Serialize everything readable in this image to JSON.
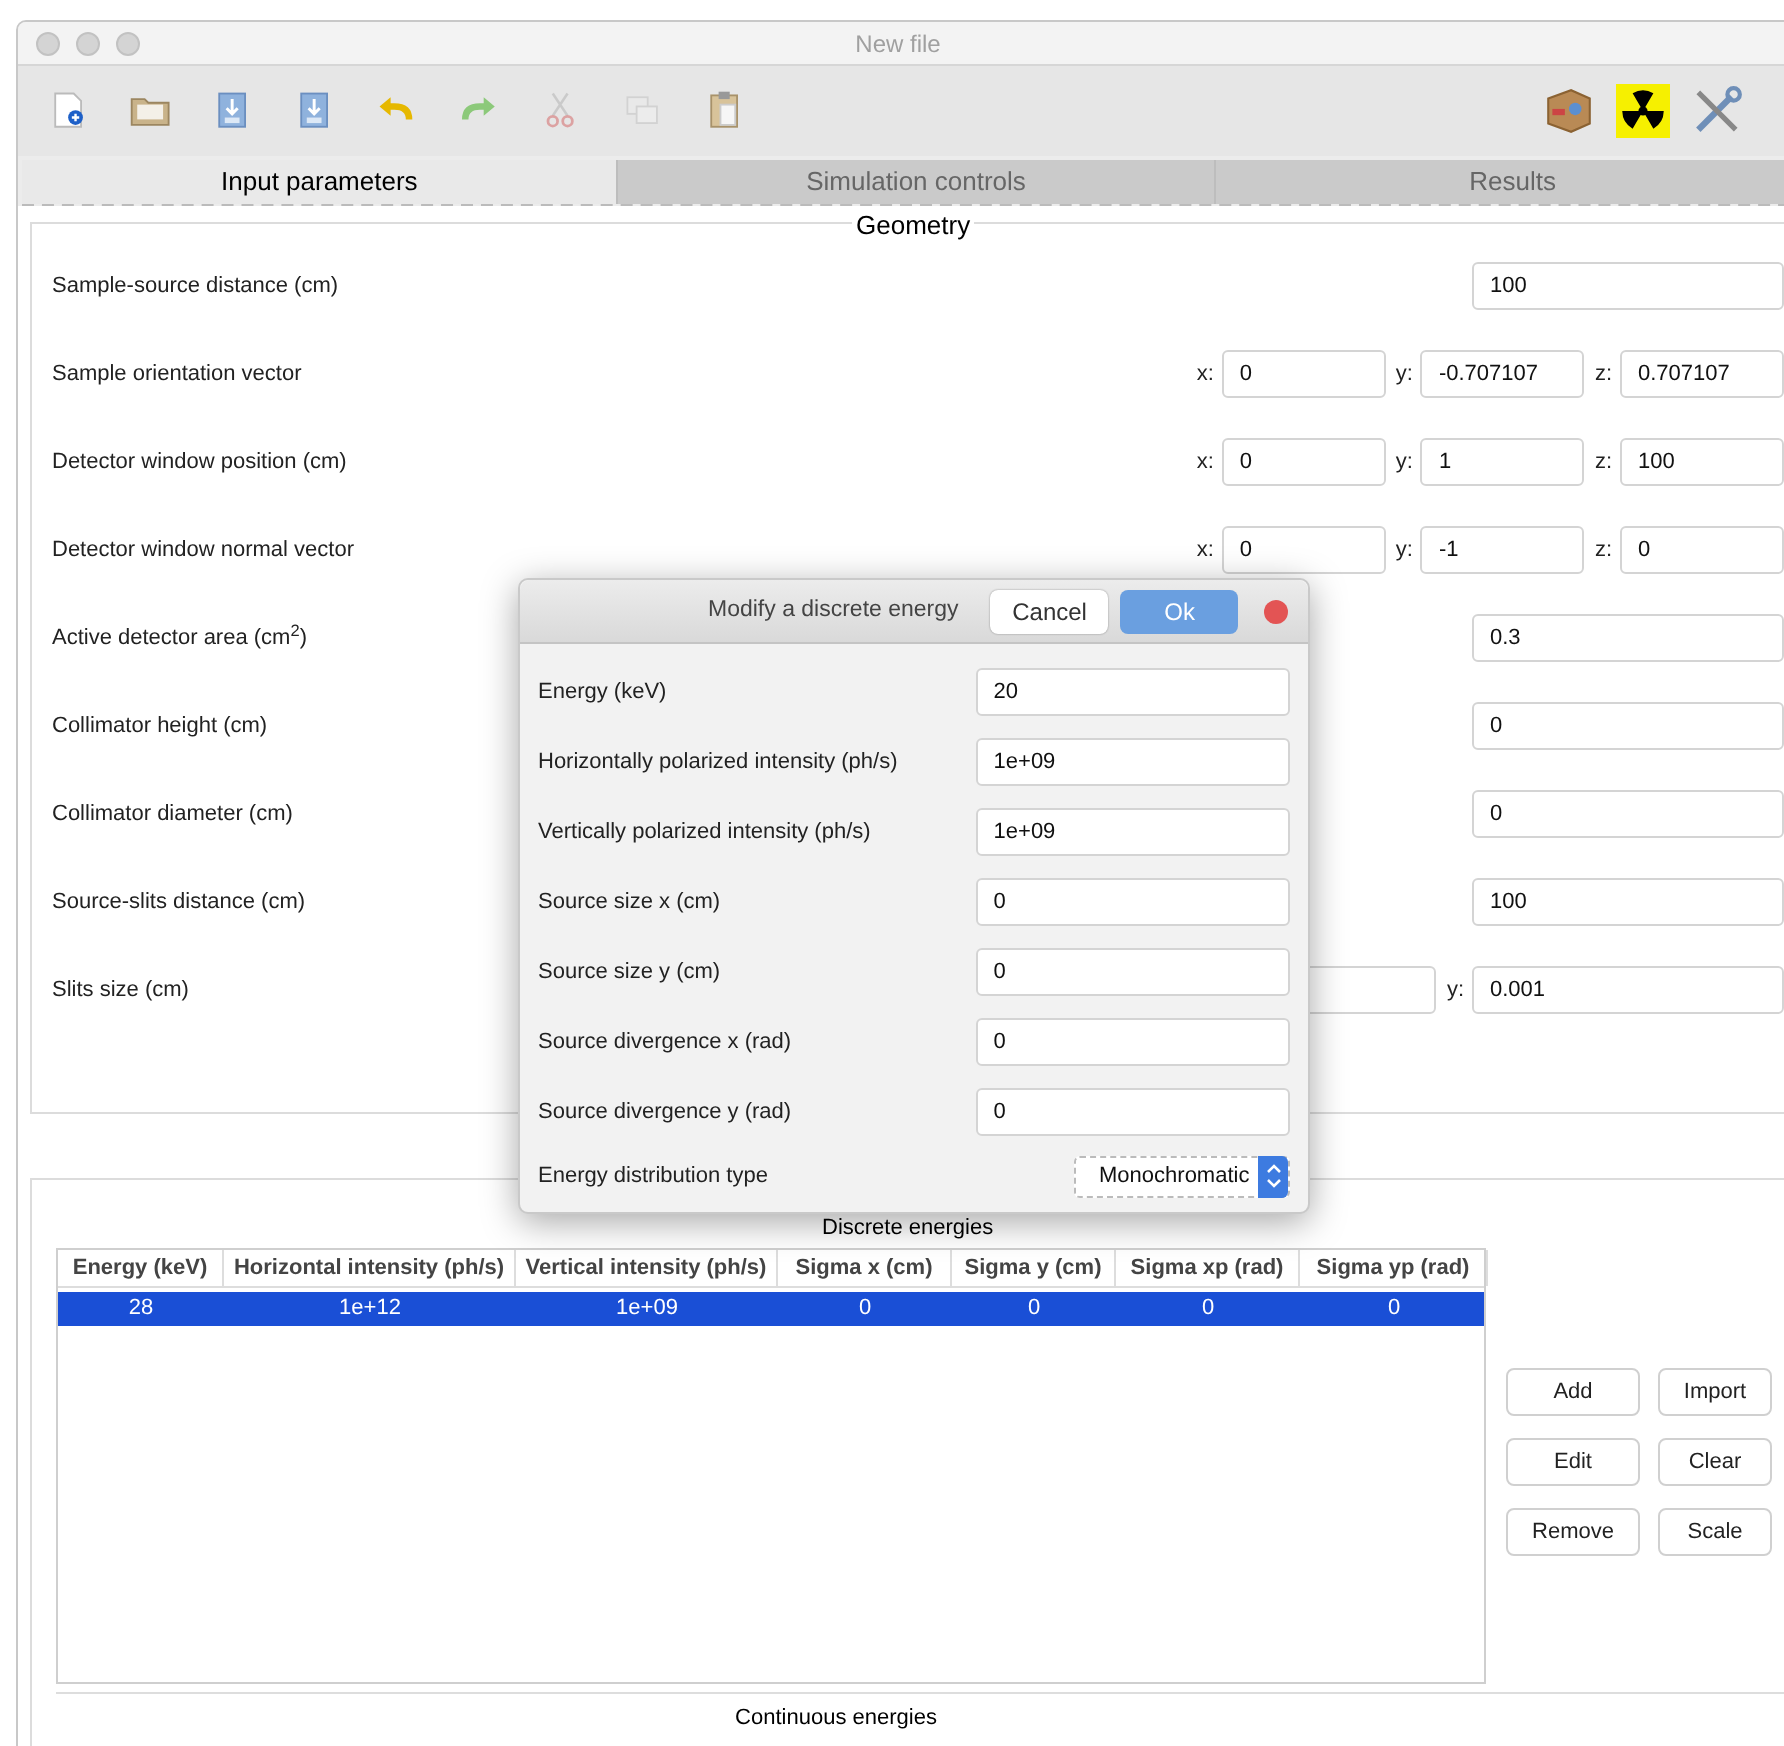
{
  "window": {
    "title": "New file"
  },
  "toolbar": {
    "left": [
      {
        "kind": "new",
        "disabled": false
      },
      {
        "kind": "open",
        "disabled": false
      },
      {
        "kind": "save",
        "disabled": false
      },
      {
        "kind": "saveas",
        "disabled": false
      },
      {
        "kind": "undo",
        "disabled": false
      },
      {
        "kind": "redo",
        "disabled": false
      },
      {
        "kind": "cut",
        "disabled": true
      },
      {
        "kind": "copy",
        "disabled": true
      },
      {
        "kind": "paste",
        "disabled": false
      }
    ],
    "right": [
      {
        "kind": "box"
      },
      {
        "kind": "radiation"
      },
      {
        "kind": "tools"
      }
    ]
  },
  "tabs": [
    {
      "label": "Input parameters",
      "selected": true
    },
    {
      "label": "Simulation controls",
      "selected": false
    },
    {
      "label": "Results",
      "selected": false
    }
  ],
  "geometry": {
    "title": "Geometry",
    "rows": [
      {
        "kind": "single",
        "label": "Sample-source distance (cm)",
        "fields": [
          {
            "value": "100"
          }
        ]
      },
      {
        "kind": "vector",
        "label": "Sample orientation vector",
        "fields": [
          {
            "axis": "x:",
            "value": "0"
          },
          {
            "axis": "y:",
            "value": "-0.707107"
          },
          {
            "axis": "z:",
            "value": "0.707107"
          }
        ]
      },
      {
        "kind": "vector",
        "label": "Detector window position (cm)",
        "fields": [
          {
            "axis": "x:",
            "value": "0"
          },
          {
            "axis": "y:",
            "value": "1"
          },
          {
            "axis": "z:",
            "value": "100"
          }
        ]
      },
      {
        "kind": "vector",
        "label": "Detector window normal vector",
        "fields": [
          {
            "axis": "x:",
            "value": "0"
          },
          {
            "axis": "y:",
            "value": "-1"
          },
          {
            "axis": "z:",
            "value": "0"
          }
        ]
      },
      {
        "kind": "single",
        "label": "Active detector area (cm$^{2}$)",
        "fields": [
          {
            "value": "0.3"
          }
        ]
      },
      {
        "kind": "single",
        "label": "Collimator height (cm)",
        "fields": [
          {
            "value": "0"
          }
        ]
      },
      {
        "kind": "single",
        "label": "Collimator diameter (cm)",
        "fields": [
          {
            "value": "0"
          }
        ]
      },
      {
        "kind": "single",
        "label": "Source-slits distance (cm)",
        "fields": [
          {
            "value": "100"
          }
        ]
      },
      {
        "kind": "pair",
        "label": "Slits size (cm)",
        "fields": [
          {
            "axis": "y:",
            "value": "0.001"
          }
        ]
      }
    ]
  },
  "discrete_energies": {
    "title": "Discrete energies",
    "columns": [
      "Energy (keV)",
      "Horizontal intensity (ph/s)",
      "Vertical intensity (ph/s)",
      "Sigma x (cm)",
      "Sigma y (cm)",
      "Sigma xp (rad)",
      "Sigma yp (rad)"
    ],
    "rows": [
      {
        "selected": true,
        "cells": [
          "28",
          "1e+12",
          "1e+09",
          "0",
          "0",
          "0",
          "0"
        ]
      }
    ],
    "buttons": [
      "Add",
      "Import",
      "Edit",
      "Clear",
      "Remove",
      "Scale"
    ]
  },
  "continuous_energies": {
    "title": "Continuous energies"
  },
  "dialog": {
    "title": "Modify a discrete energy",
    "cancel": "Cancel",
    "ok": "Ok",
    "fields": [
      {
        "label": "Energy (keV)",
        "value": "20"
      },
      {
        "label": "Horizontally polarized intensity (ph/s)",
        "value": "1e+09"
      },
      {
        "label": "Vertically polarized intensity (ph/s)",
        "value": "1e+09"
      },
      {
        "label": "Source size x (cm)",
        "value": "0"
      },
      {
        "label": "Source size y (cm)",
        "value": "0"
      },
      {
        "label": "Source divergence x (rad)",
        "value": "0"
      },
      {
        "label": "Source divergence y (rad)",
        "value": "0"
      }
    ],
    "distribution": {
      "label": "Energy distribution type",
      "value": "Monochromatic"
    }
  }
}
